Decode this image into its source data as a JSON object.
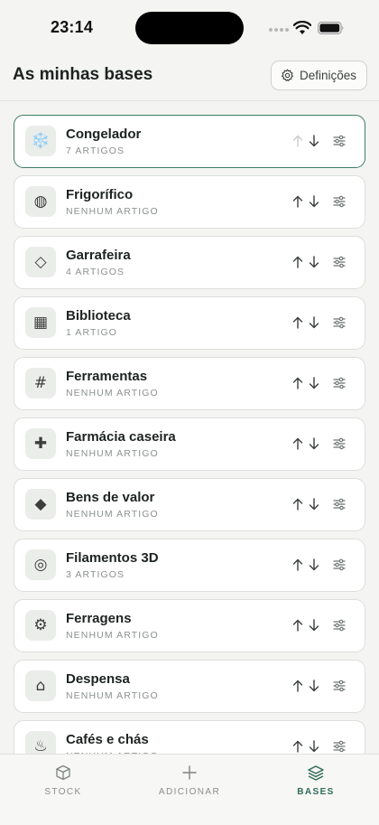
{
  "status_bar": {
    "time": "23:14"
  },
  "header": {
    "title": "As minhas bases",
    "settings_label": "Definições"
  },
  "bases": [
    {
      "name": "Congelador",
      "count": "7 ARTIGOS",
      "icon": "snowflake",
      "glyph": "❄️",
      "active": true
    },
    {
      "name": "Frigorífico",
      "count": "NENHUM ARTIGO",
      "icon": "fridge",
      "glyph": "◍",
      "active": false
    },
    {
      "name": "Garrafeira",
      "count": "4 ARTIGOS",
      "icon": "diamond-outline",
      "glyph": "◇",
      "active": false
    },
    {
      "name": "Biblioteca",
      "count": "1 ARTIGO",
      "icon": "square",
      "glyph": "▦",
      "active": false
    },
    {
      "name": "Ferramentas",
      "count": "NENHUM ARTIGO",
      "icon": "hash",
      "glyph": "#",
      "active": false
    },
    {
      "name": "Farmácia caseira",
      "count": "NENHUM ARTIGO",
      "icon": "cross",
      "glyph": "✚",
      "active": false
    },
    {
      "name": "Bens de valor",
      "count": "NENHUM ARTIGO",
      "icon": "diamond-filled",
      "glyph": "◆",
      "active": false
    },
    {
      "name": "Filamentos 3D",
      "count": "3 ARTIGOS",
      "icon": "spool",
      "glyph": "◎",
      "active": false
    },
    {
      "name": "Ferragens",
      "count": "NENHUM ARTIGO",
      "icon": "gear",
      "glyph": "⚙",
      "active": false
    },
    {
      "name": "Despensa",
      "count": "NENHUM ARTIGO",
      "icon": "house",
      "glyph": "⌂",
      "active": false
    },
    {
      "name": "Cafés e chás",
      "count": "NENHUM ARTIGO",
      "icon": "hot-drink",
      "glyph": "♨",
      "active": false
    }
  ],
  "bottom_nav": [
    {
      "label": "STOCK",
      "icon": "box-icon",
      "active": false
    },
    {
      "label": "ADICIONAR",
      "icon": "plus-icon",
      "active": false
    },
    {
      "label": "BASES",
      "icon": "layers-icon",
      "active": true
    }
  ],
  "colors": {
    "accent": "#2f6b58",
    "active_border": "#3c7c66",
    "background": "#f4f5f3"
  }
}
